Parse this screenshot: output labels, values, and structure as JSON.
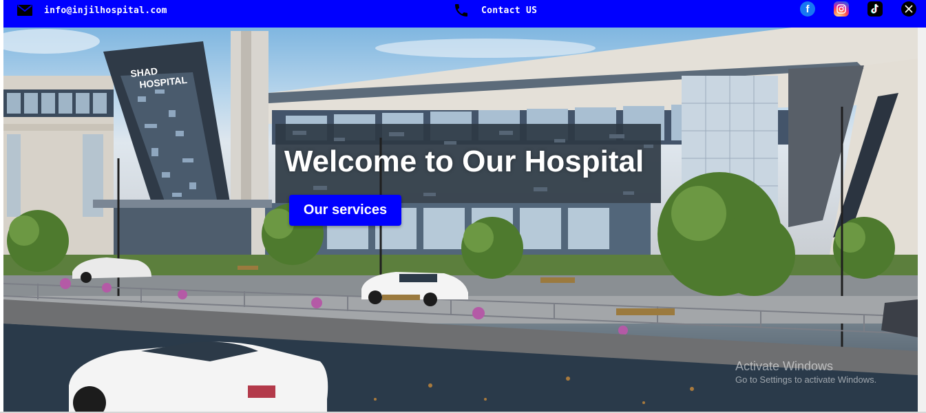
{
  "topbar": {
    "email": "info@injilhospital.com",
    "contact": "Contact US",
    "email_icon": "envelope-icon",
    "phone_icon": "phone-icon",
    "social": [
      "facebook-icon",
      "instagram-icon",
      "tiktok-icon",
      "x-icon"
    ],
    "bg_color": "#0000ff"
  },
  "hero": {
    "title": "Welcome to Our Hospital",
    "button_label": "Our services",
    "button_color": "#0000ff",
    "building_sign": "SHAD HOSPITAL"
  },
  "os_watermark": {
    "line1": "Activate Windows",
    "line2": "Go to Settings to activate Windows."
  }
}
